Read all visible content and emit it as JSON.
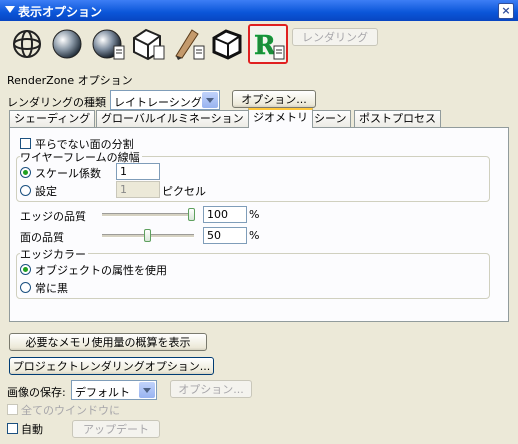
{
  "window": {
    "title": "表示オプション",
    "close_label": "×"
  },
  "toolbar": {
    "render_button": "レンダリング"
  },
  "renderer": {
    "title": "RenderZone オプション",
    "type_label": "レンダリングの種類",
    "type_value": "レイトレーシング",
    "options_button": "オプション..."
  },
  "tabs": [
    "シェーディング",
    "グローバルイルミネーション",
    "ジオメトリ",
    "シーン",
    "ポストプロセス"
  ],
  "geometry": {
    "split_nonplanar": "平らでない面の分割",
    "wire_group": "ワイヤーフレームの線幅",
    "scale_factor_label": "スケール係数",
    "scale_factor_value": "1",
    "set_label": "設定",
    "set_value": "1",
    "pixel_unit": "ピクセル",
    "edge_quality_label": "エッジの品質",
    "edge_quality_value": "100",
    "face_quality_label": "面の品質",
    "face_quality_value": "50",
    "percent": "%",
    "edge_color_group": "エッジカラー",
    "use_object_attr": "オブジェクトの属性を使用",
    "always_black": "常に黒"
  },
  "bottom": {
    "memory_button": "必要なメモリ使用量の概算を表示",
    "project_button": "プロジェクトレンダリングオプション...",
    "save_label": "画像の保存:",
    "save_value": "デフォルト",
    "save_options_button": "オプション...",
    "all_windows": "全てのウインドウに",
    "auto": "自動",
    "update_button": "アップデート"
  },
  "state": {
    "edge_quality_fraction": 1.0,
    "face_quality_fraction": 0.5
  }
}
